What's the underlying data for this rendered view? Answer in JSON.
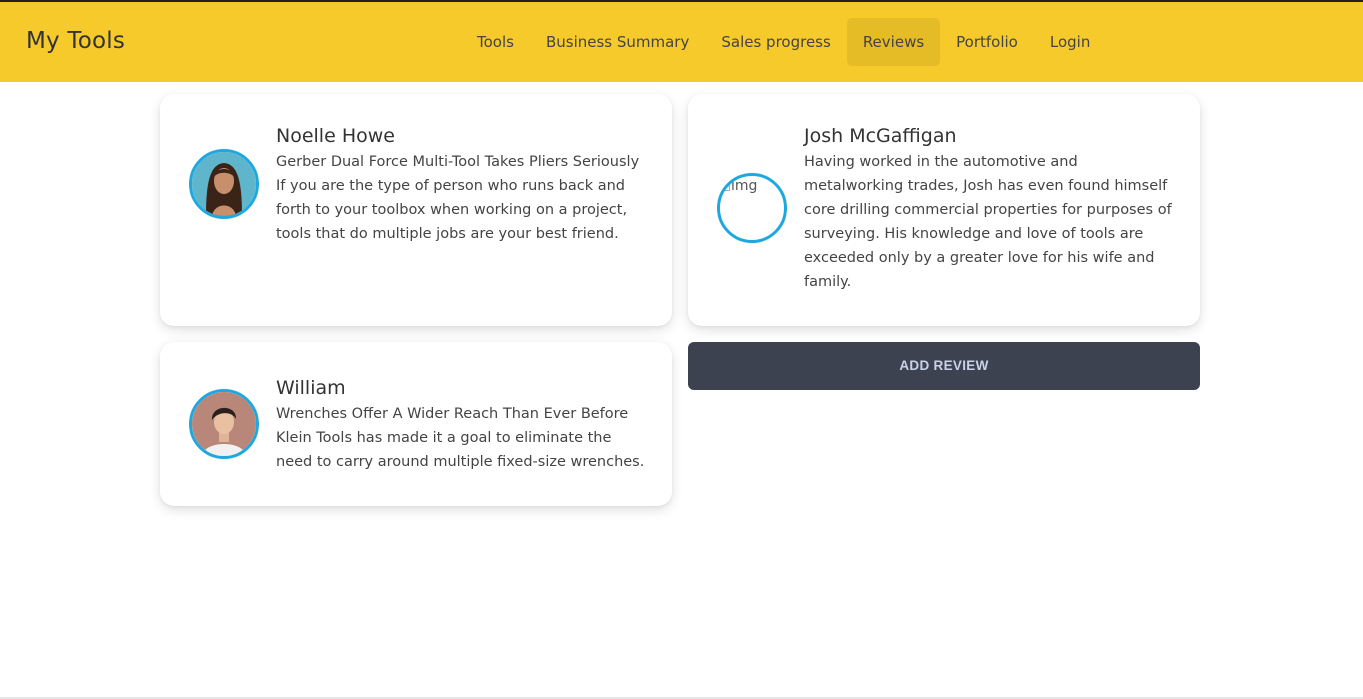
{
  "header": {
    "brand": "My Tools",
    "nav": [
      {
        "label": "Tools"
      },
      {
        "label": "Business Summary"
      },
      {
        "label": "Sales progress"
      },
      {
        "label": "Reviews",
        "active": true
      },
      {
        "label": "Portfolio"
      },
      {
        "label": "Login"
      }
    ]
  },
  "reviews": [
    {
      "name": "Noelle Howe",
      "lines": [
        "Gerber Dual Force Multi-Tool Takes Pliers Seriously",
        "If you are the type of person who runs back and",
        "forth to your toolbox when working on a project,",
        "tools that do multiple jobs are your best friend."
      ],
      "avatar": "woman-portrait-icon"
    },
    {
      "name": "Josh McGaffigan",
      "lines": [
        "Having worked in the automotive and",
        "metalworking trades, Josh has even found himself",
        "core drilling commercial properties for purposes of",
        "surveying. His knowledge and love of tools are",
        "exceeded only by a greater love for his wife and",
        "family."
      ],
      "avatar_alt": "img"
    },
    {
      "name": "William",
      "lines": [
        "Wrenches Offer A Wider Reach Than Ever Before",
        "Klein Tools has made it a goal to eliminate the",
        "need to carry around multiple fixed-size wrenches."
      ],
      "avatar": "man-portrait-icon"
    }
  ],
  "actions": {
    "add_review": "ADD REVIEW"
  },
  "colors": {
    "navbar": "#f7ca2c",
    "nav_active": "#e5bb26",
    "avatar_border": "#1fa8e0",
    "button_bg": "#3d4250",
    "button_text": "#c9d3e6"
  }
}
